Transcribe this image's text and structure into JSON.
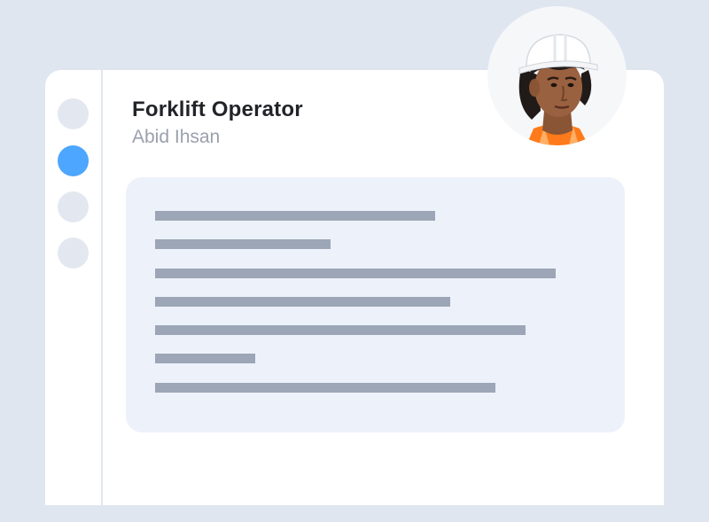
{
  "profile": {
    "job_title": "Forklift Operator",
    "name": "Abid Ihsan"
  },
  "sidebar": {
    "items": [
      {
        "state": "inactive"
      },
      {
        "state": "active"
      },
      {
        "state": "inactive"
      },
      {
        "state": "inactive"
      }
    ]
  },
  "content": {
    "placeholder_lines": 7
  },
  "colors": {
    "background": "#e0e6f0",
    "accent": "#4da6ff",
    "placeholder": "#9ca6b6",
    "panel": "#edf2fa"
  }
}
